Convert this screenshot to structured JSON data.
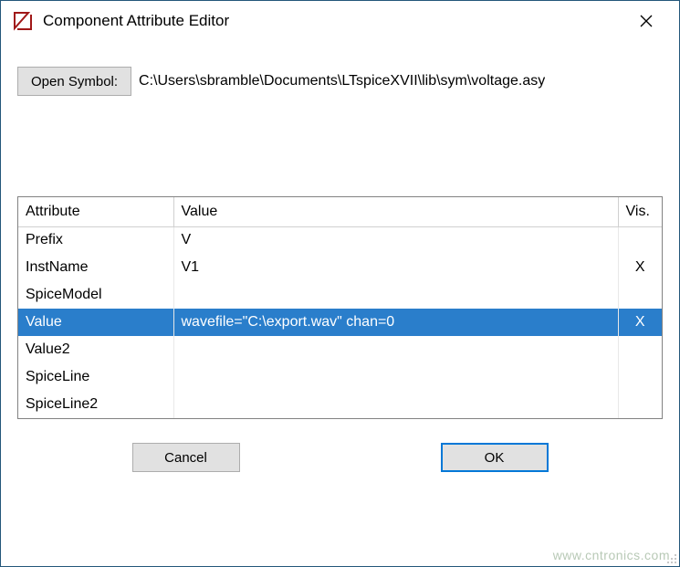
{
  "window": {
    "title": "Component Attribute Editor"
  },
  "toolbar": {
    "open_symbol_label": "Open Symbol:",
    "symbol_path": "C:\\Users\\sbramble\\Documents\\LTspiceXVII\\lib\\sym\\voltage.asy"
  },
  "table": {
    "headers": {
      "attribute": "Attribute",
      "value": "Value",
      "vis": "Vis."
    },
    "rows": [
      {
        "attr": "Prefix",
        "value": "V",
        "vis": "",
        "selected": false
      },
      {
        "attr": "InstName",
        "value": "V1",
        "vis": "X",
        "selected": false
      },
      {
        "attr": "SpiceModel",
        "value": "",
        "vis": "",
        "selected": false
      },
      {
        "attr": "Value",
        "value": "wavefile=\"C:\\export.wav\" chan=0",
        "vis": "X",
        "selected": true
      },
      {
        "attr": "Value2",
        "value": "",
        "vis": "",
        "selected": false
      },
      {
        "attr": "SpiceLine",
        "value": "",
        "vis": "",
        "selected": false
      },
      {
        "attr": "SpiceLine2",
        "value": "",
        "vis": "",
        "selected": false
      }
    ]
  },
  "buttons": {
    "cancel": "Cancel",
    "ok": "OK"
  },
  "watermark": "www.cntronics.com"
}
